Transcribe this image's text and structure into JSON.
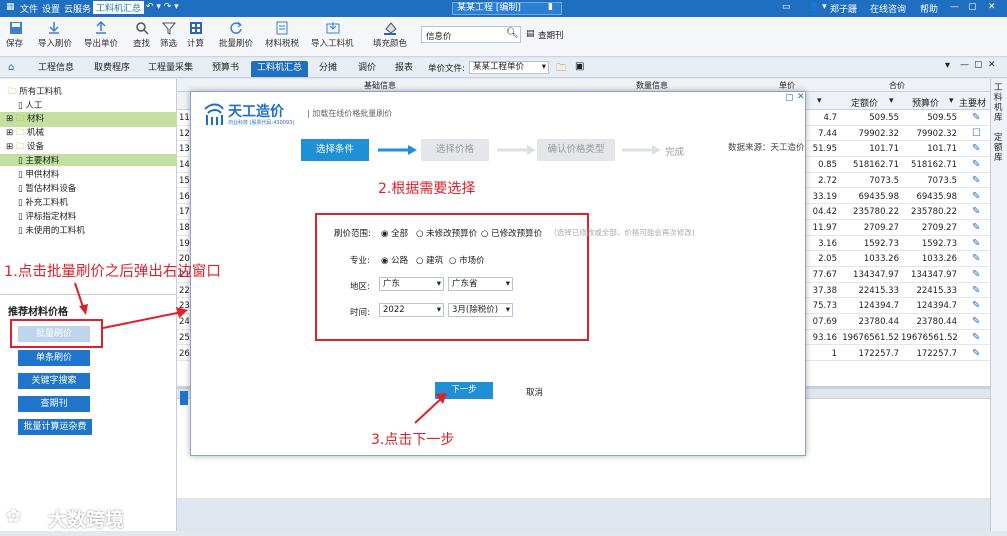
{
  "titlebar": {
    "menus": [
      "文件",
      "设置",
      "云服务",
      "工料机汇总"
    ],
    "title": "某某工程 [编制]",
    "user": "郑子跚",
    "help_items": [
      "在线咨询",
      "帮助"
    ]
  },
  "ribbon": {
    "buttons": [
      "保存",
      "导入刷价",
      "导出单价",
      "查找",
      "筛选",
      "计算",
      "批量刷价",
      "材料税税",
      "导入工料机",
      "填充颜色"
    ],
    "search_label": "信息价",
    "period_label": "查期刊"
  },
  "tabs": [
    "工程信息",
    "取费程序",
    "工程量采集",
    "预算书",
    "工料机汇总",
    "分摊",
    "调价",
    "报表"
  ],
  "unit_file": {
    "label": "单价文件:",
    "value": "某某工程单价"
  },
  "tree": {
    "root": "所有工料机",
    "items": [
      "人工",
      "材料",
      "机械",
      "设备",
      "主要材料",
      "甲供材料",
      "暂估材料设备",
      "补充工料机",
      "评标指定材料",
      "未使用的工料机"
    ]
  },
  "recommend": {
    "title": "推荐材料价格",
    "buttons": [
      "批量刷价",
      "单条刷价",
      "关键字搜索",
      "查期刊",
      "批量计算运杂费"
    ]
  },
  "grid": {
    "group_headers": [
      "基础信息",
      "数量信息",
      "单价",
      "合价"
    ],
    "headers": [
      "定额价",
      "预算价",
      "主要材"
    ],
    "row_numbers": [
      "11",
      "12",
      "13",
      "14",
      "15",
      "16",
      "17",
      "18",
      "19",
      "20",
      "21",
      "22",
      "23",
      "24",
      "25",
      "26"
    ],
    "price_col": [
      "4.7",
      "7.44",
      "51.95",
      "0.85",
      "2.72",
      "33.19",
      "04.42",
      "11.97",
      "3.16",
      "2.05",
      "77.67",
      "37.38",
      "75.73",
      "07.69",
      "93.16",
      "1"
    ],
    "quota_col": [
      "509.55",
      "79902.32",
      "101.71",
      "518162.71",
      "7073.5",
      "69435.98",
      "235780.22",
      "2709.27",
      "1592.73",
      "1033.26",
      "134347.97",
      "22415.33",
      "124394.7",
      "23780.44",
      "19676561.52",
      "172257.7"
    ],
    "budget_col": [
      "509.55",
      "79902.32",
      "101.71",
      "518162.71",
      "7073.5",
      "69435.98",
      "235780.22",
      "2709.27",
      "1592.73",
      "1033.26",
      "134347.97",
      "22415.33",
      "124394.7",
      "23780.44",
      "19676561.52",
      "172257.7"
    ]
  },
  "sidebar": [
    "工料机库",
    "定额库"
  ],
  "dialog": {
    "logo": "天工造价",
    "logo_sub": "鸿业科技 (股票代码:430093)",
    "subtitle": "| 加载在线价格批量刷价",
    "steps": [
      "选择条件",
      "选择价格",
      "确认价格类型",
      "完成"
    ],
    "source": "数据来源：天工造价",
    "form": {
      "range_label": "刷价范围:",
      "range_options": [
        "全部",
        "未修改预算价",
        "已修改预算价"
      ],
      "range_note": "(选择已修改或全部，价格可能会再次修改)",
      "major_label": "专业:",
      "major_options": [
        "公路",
        "建筑",
        "市场价"
      ],
      "region_label": "地区:",
      "region_values": [
        "广东",
        "广东省"
      ],
      "time_label": "时间:",
      "time_values": [
        "2022",
        "3月(除税价)"
      ]
    },
    "next": "下一步",
    "cancel": "取消"
  },
  "annotations": {
    "a1": "1.点击批量刷价之后弹出右边窗口",
    "a2": "2.根据需要选择",
    "a3": "3.点击下一步"
  },
  "watermark": "大数跨境",
  "colors": {
    "brand": "#1f6fc1",
    "annotation": "#e0202a",
    "tree_selected": "#c4e0a0"
  }
}
